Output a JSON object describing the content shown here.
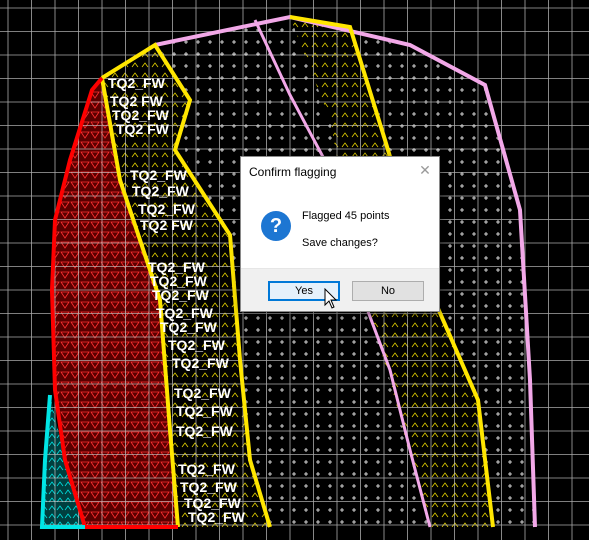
{
  "canvas": {
    "labels": [
      "TQ2_FW",
      "TQ2 FW",
      "TQ2_FW",
      "TQ2 FW",
      "TQ2_FW",
      "TQ2_FW",
      "TQ2_FW",
      "TQ2 FW",
      "TQ2_FW",
      "TQ2_FW",
      "TQ2_FW",
      "TQ2_FW",
      "TQ2_FW",
      "TQ2_FW",
      "TQ2_FW",
      "TQ2_FW",
      "TQ2_FW",
      "TQ2_FW",
      "TQ2_FW",
      "TQ2_FW",
      "TQ2_FW",
      "TQ2_FW"
    ],
    "colors": {
      "background": "#000000",
      "grid": "#c8c8c8",
      "red_zone": "#ff0000",
      "yellow_zone": "#ffe600",
      "pink_outline": "#f2a8e8",
      "cyan_zone": "#00e5e5"
    }
  },
  "dialog": {
    "title": "Confirm flagging",
    "close_icon": "close-icon",
    "icon": "question-icon",
    "icon_glyph": "?",
    "message": "Flagged 45 points",
    "question": "Save changes?",
    "yes_label": "Yes",
    "no_label": "No"
  }
}
